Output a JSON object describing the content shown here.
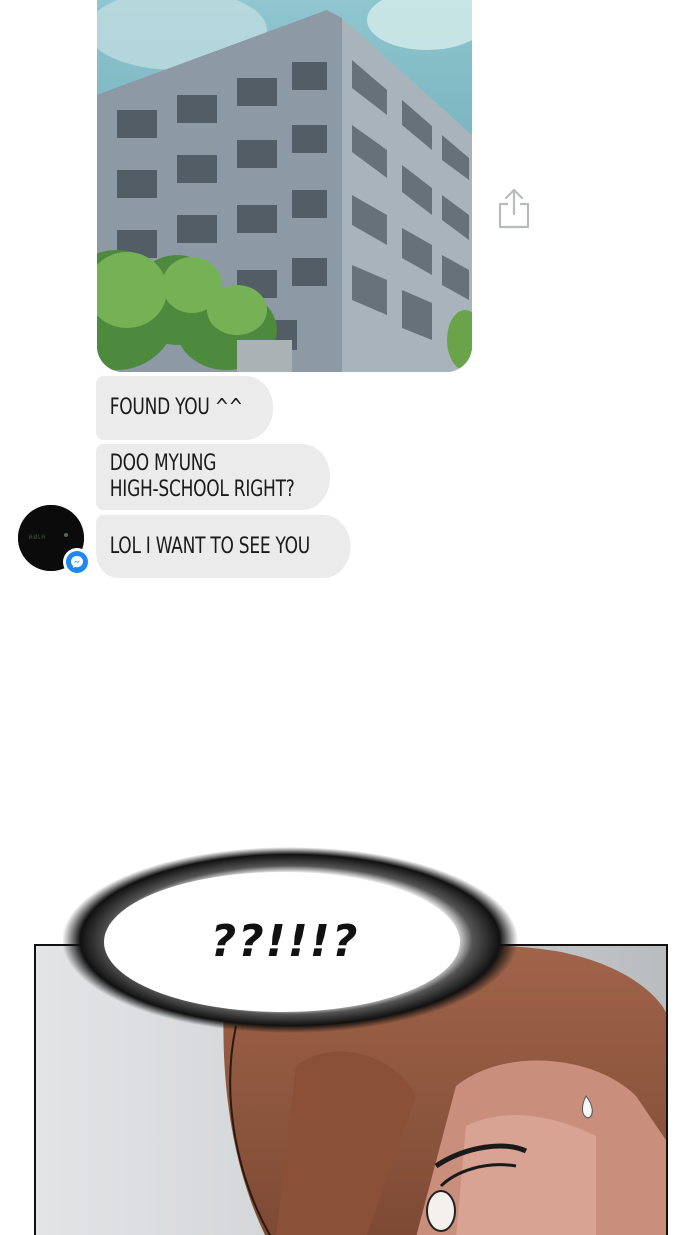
{
  "chat": {
    "messages": [
      {
        "lines": [
          "FOUND YOU ^^"
        ]
      },
      {
        "lines": [
          "DOO MYUNG",
          "HIGH-SCHOOL RIGHT?"
        ]
      },
      {
        "lines": [
          "LOL I WANT TO SEE YOU"
        ]
      }
    ],
    "share_icon": "share-icon",
    "badge_icon": "messenger-icon",
    "colors": {
      "bubble": "#ebebeb",
      "badge": "#1e88f0"
    }
  },
  "panel": {
    "shout": "??!!!?"
  }
}
